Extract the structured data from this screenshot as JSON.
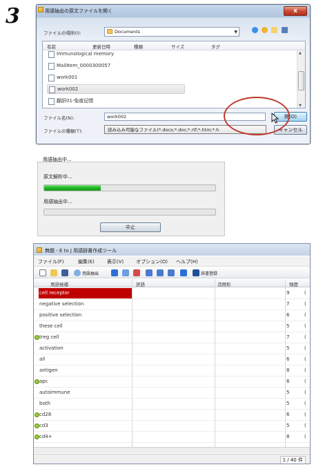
{
  "step_number": "3",
  "open_dialog": {
    "title": "用語抽出の原文ファイルを開く",
    "close_glyph": "x",
    "location_label": "ファイルの場所(I):",
    "location_value": "Documents",
    "columns": [
      "名前",
      "更新日時",
      "種類",
      "サイズ",
      "タグ"
    ],
    "files": [
      "Immunological memory",
      "MailItem_0000300057",
      "work001",
      "work002",
      "翻訳01-免疫記憶"
    ],
    "selected_file": "work002",
    "filename_label": "ファイル名(N):",
    "filename_value": "work002",
    "filetype_label": "ファイルの種類(T):",
    "filetype_value": "読み込み可能なファイル(*.docx;*.doc;*.rtf;*.htm;*.h",
    "open_button": "開(O)",
    "cancel_button": "キャンセル"
  },
  "progress_dialog": {
    "title": "用語抽出中...",
    "step1_label": "原文解析中...",
    "step1_progress": 0.33,
    "step2_label": "用語抽出中...",
    "step2_progress": 0,
    "stop_button": "中止"
  },
  "app_window": {
    "title": "無題 - E to J 用語辞書作成ツール",
    "menu": [
      "ファイル(F)",
      "編集(E)",
      "表示(V)",
      "オプション(O)",
      "ヘルプ(H)"
    ],
    "toolbar_texts": {
      "extract": "用語抽出",
      "register": "辞書登録"
    },
    "columns": [
      "用語候補",
      "訳語",
      "活用形",
      "頻度"
    ],
    "rows": [
      {
        "term": "cell receptor",
        "freq": "9",
        "selected": true,
        "flag": false
      },
      {
        "term": "negative selection",
        "freq": "7",
        "selected": false,
        "flag": false
      },
      {
        "term": "positive selection",
        "freq": "6",
        "selected": false,
        "flag": false
      },
      {
        "term": "these cell",
        "freq": "5",
        "selected": false,
        "flag": false
      },
      {
        "term": "treg cell",
        "freq": "7",
        "selected": false,
        "flag": true
      },
      {
        "term": "activation",
        "freq": "5",
        "selected": false,
        "flag": false
      },
      {
        "term": "all",
        "freq": "6",
        "selected": false,
        "flag": false
      },
      {
        "term": "antigen",
        "freq": "8",
        "selected": false,
        "flag": false
      },
      {
        "term": "apc",
        "freq": "6",
        "selected": false,
        "flag": true
      },
      {
        "term": "autoimmune",
        "freq": "5",
        "selected": false,
        "flag": false
      },
      {
        "term": "both",
        "freq": "5",
        "selected": false,
        "flag": false
      },
      {
        "term": "cd28",
        "freq": "6",
        "selected": false,
        "flag": true
      },
      {
        "term": "cd3",
        "freq": "5",
        "selected": false,
        "flag": true
      },
      {
        "term": "cd4+",
        "freq": "8",
        "selected": false,
        "flag": true
      }
    ],
    "status_count": "1 / 40 件"
  },
  "colors": {
    "selected_row": "#c00000",
    "annotation": "#c0392b",
    "progress": "#21b521"
  }
}
